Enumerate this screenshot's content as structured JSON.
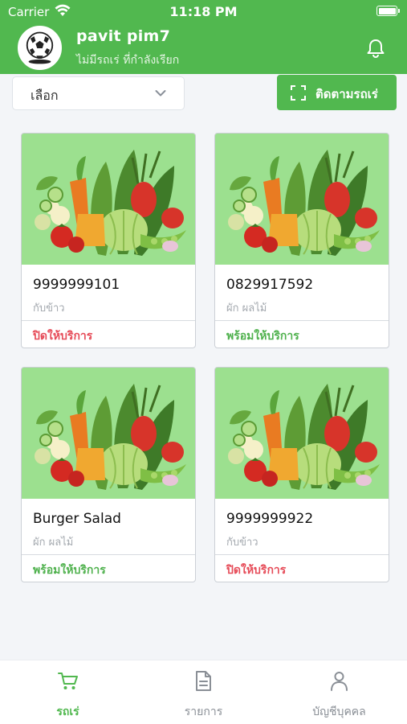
{
  "status_bar": {
    "carrier": "Carrier",
    "time": "11:18 PM"
  },
  "header": {
    "user_name": "pavit pim7",
    "subtitle": "ไม่มีรถเร่ ที่กำลังเรียก"
  },
  "toolbar": {
    "select_label": "เลือก",
    "track_button": "ติดตามรถเร่"
  },
  "cards": [
    {
      "title": "9999999101",
      "subtitle": "กับข้าว",
      "status": "ปิดให้บริการ",
      "status_type": "closed"
    },
    {
      "title": "0829917592",
      "subtitle": "ผัก ผลไม้",
      "status": "พร้อมให้บริการ",
      "status_type": "open"
    },
    {
      "title": "Burger Salad",
      "subtitle": "ผัก ผลไม้",
      "status": "พร้อมให้บริการ",
      "status_type": "open"
    },
    {
      "title": "9999999922",
      "subtitle": "กับข้าว",
      "status": "ปิดให้บริการ",
      "status_type": "closed"
    }
  ],
  "tabs": [
    {
      "label": "รถเร่",
      "icon": "cart-icon",
      "active": true
    },
    {
      "label": "รายการ",
      "icon": "document-icon",
      "active": false
    },
    {
      "label": "บัญชีบุคคล",
      "icon": "person-icon",
      "active": false
    }
  ],
  "colors": {
    "brand_green": "#51b84f",
    "closed_red": "#e64b58",
    "open_green": "#4fb14d"
  }
}
